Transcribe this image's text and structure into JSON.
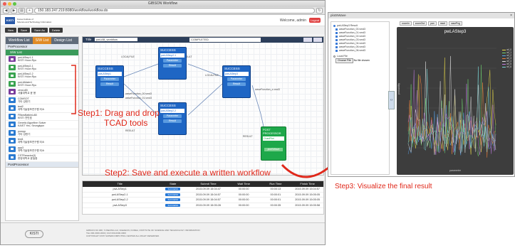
{
  "browser": {
    "window_title": "GIBSON Workflow",
    "url": "150.183.247.219:8080/workflow/workflow.do"
  },
  "header": {
    "org_name_line1": "Korea Institute of",
    "org_name_line2": "Science and Technology Information",
    "welcome": "Welcome, admin",
    "logout": "Logout"
  },
  "toolbar": {
    "new": "New",
    "save": "Save",
    "save_as": "Save As",
    "delete": "Delete"
  },
  "sidebar": {
    "tabs": [
      "Workflow List",
      "S/W List",
      "Design List"
    ],
    "group_pre": "PreProcessor",
    "subgroup": "S/W List",
    "items": [
      {
        "name": "pwLAStep1-1",
        "org": "KISTI Hoon Ryu",
        "color": "#7a3c9c"
      },
      {
        "name": "pwLAStep2-1",
        "org": "KISTI Hoon Ryu",
        "color": "#3aa350"
      },
      {
        "name": "pwLAStep2-2",
        "org": "KISTI Hoon Ryu",
        "color": "#3aa350"
      },
      {
        "name": "pwLAMater1",
        "org": "KISTI Hoon Ryu",
        "color": "#3aa350"
      },
      {
        "name": "zeroLAB",
        "org": "서울대학교 윤 용",
        "color": "#7a3c9c"
      },
      {
        "name": "COMSOT",
        "org": "기타 강한기",
        "color": "#2a7ad0"
      },
      {
        "name": "test2",
        "org": "과학기술정보연구원 티소",
        "color": "#2a7ad0"
      },
      {
        "name": "FBlowBatkinLAB",
        "org": "KISTI 천민호",
        "color": "#2a7ad0"
      },
      {
        "name": "Genetic Algorithm Solver",
        "org": "KAIST Yeo, Seungkyun",
        "color": "#2a7ad0"
      },
      {
        "name": "pompp",
        "org": "기타 강한기",
        "color": "#2a7ad0"
      },
      {
        "name": "test1",
        "org": "과학기술정보연구원 티소",
        "color": "#2a7ad0"
      },
      {
        "name": "ppp3",
        "org": "과학기술정보연구원 티소",
        "color": "#2a7ad0"
      },
      {
        "name": "CSTRreactor(3)",
        "org": "한양대학교 윤일중",
        "color": "#2a7ad0"
      }
    ],
    "group_post": "PostProcessor"
  },
  "canvas": {
    "title_label": "Title",
    "workflow_name": "pwLAB_workflow",
    "status": "COMPLETED",
    "nodes": [
      {
        "state": "SUCCESS",
        "name": "pwLAStep1",
        "btn1": "Parameter",
        "btn2": "Result"
      },
      {
        "state": "SUCCESS",
        "name": "pwLAStep2-1",
        "btn1": "Parameter",
        "btn2": "Result"
      },
      {
        "state": "SUCCESS",
        "name": "pwLAStep2-2",
        "btn1": "Parameter",
        "btn2": "Result"
      },
      {
        "state": "SUCCESS",
        "name": "pwLAStep3",
        "btn1": "Parameter",
        "btn2": "Result"
      }
    ],
    "post_node": {
      "title": "POST PROCESSOR",
      "name": "ChartPlot",
      "btn": "plotSWave"
    },
    "edge_labels": [
      "LOCALFILE",
      "RESULT",
      "LOCALFILE",
      "RESULT",
      "waveFunction_00.vmd3",
      "waveFunction_01.vmd3",
      "waveFunction_z.vmd3",
      "RESULT"
    ]
  },
  "table": {
    "headers": [
      "Title",
      "State",
      "Submit Time",
      "Wait Time",
      "Run Time",
      "Finish Time"
    ],
    "rows": [
      [
        "pwLAStep1",
        "SUCCESS",
        "2015.09.09 15:04:47",
        "00:00:00",
        "00:00:13",
        "2015.09.09 15:04:57"
      ],
      [
        "pwLAStep2-1",
        "SUCCESS",
        "2015.09.09 15:04:57",
        "00:00:00",
        "00:00:01",
        "2015.09.09 15:05:05"
      ],
      [
        "pwLAStep2-2",
        "SUCCESS",
        "2015.09.09 15:04:57",
        "00:00:00",
        "00:00:01",
        "2015.09.09 15:05:05"
      ],
      [
        "pwLAStep3",
        "SUCCESS",
        "2015.09.09 15:05:28",
        "00:00:00",
        "00:00:35",
        "2015.09.09 15:05:58"
      ]
    ]
  },
  "footer": {
    "logo": "KISTI",
    "line1": "GIBSON NO.308, YUSEONG-GU, DAEJEON, KOREA, INSTITUTE OF SCIENCE AND TECHNOLOGY INFORMATION",
    "line2": "TEL 000-0000-0000 | FAX 000-0000-0000",
    "line3": "COPYRIGHT KISTI SUPERCOMPUTING CENTER ALL RIGHT RESERVED."
  },
  "steps": {
    "step1": "Step1: Drag and drop",
    "step1b": "TCAD tools",
    "step2": "Step2: Save and execute a written workflow",
    "step3": "Step3: Visualize the final result"
  },
  "result_panel": {
    "title": "plotSWave",
    "root": "pwLAStep3 Result",
    "files": [
      "waveFunction_00.vmd3",
      "waveFunction_01.vmd3",
      "waveFunction_02.vmd3",
      "waveFunction_03.vmd3",
      "waveFunction_04.vmd3",
      "waveFunction_05.vmd3",
      "waveFunction_06.vmd3"
    ],
    "local_file": "Local File",
    "choose_file": "Choose File",
    "no_file": "No file chosen",
    "tabs": [
      "zoomIn",
      "zoomOut",
      "pan",
      "reset",
      "savePng"
    ],
    "plot_title": "pwLAStep3",
    "xlabel": "parameter",
    "ylabel": "probability",
    "legend": [
      "wf_0",
      "wf_1",
      "wf_2",
      "wf_3",
      "wf_4",
      "wf_5",
      "wf_6"
    ],
    "colors": [
      "#f0e04a",
      "#6ed36e",
      "#5aa7f0",
      "#f07f3a",
      "#e0e0e0",
      "#c07ae0",
      "#7ad8d8"
    ]
  }
}
